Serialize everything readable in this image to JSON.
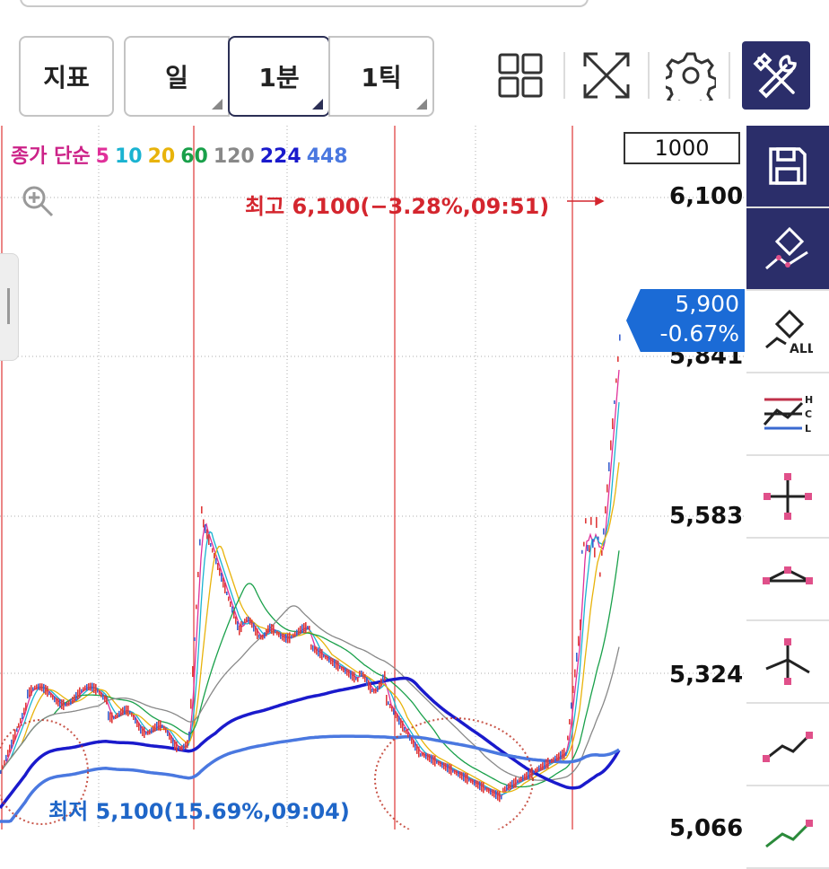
{
  "toolbar": {
    "indicator_label": "지표",
    "periods": [
      {
        "label": "일",
        "selected": false
      },
      {
        "label": "1분",
        "selected": true
      },
      {
        "label": "1틱",
        "selected": false
      }
    ],
    "icons": [
      "grid-layout-icon",
      "fullscreen-icon",
      "settings-icon",
      "tools-icon"
    ]
  },
  "chart": {
    "legend": [
      {
        "text": "종가 단순",
        "color": "#cc2288"
      },
      {
        "text": "5",
        "color": "#e0309a"
      },
      {
        "text": "10",
        "color": "#1ab3d1"
      },
      {
        "text": "20",
        "color": "#e8b30b"
      },
      {
        "text": "60",
        "color": "#19a04a"
      },
      {
        "text": "120",
        "color": "#888888"
      },
      {
        "text": "224",
        "color": "#1a1acc"
      },
      {
        "text": "448",
        "color": "#4a78e0"
      }
    ],
    "scale_box": "1000",
    "high_label": "최고 6,100(−3.28%,09:51)",
    "low_label": "최저 5,100(15.69%,09:04)",
    "current_price": "5,900",
    "current_change": "-0.67%",
    "price_ticks": [
      "6,100",
      "5,841",
      "5,583",
      "5,324",
      "5,066"
    ]
  },
  "chart_data": {
    "type": "line",
    "title": "",
    "series": [
      {
        "name": "5",
        "color": "#e0309a"
      },
      {
        "name": "10",
        "color": "#1ab3d1"
      },
      {
        "name": "20",
        "color": "#e8b30b"
      },
      {
        "name": "60",
        "color": "#19a04a"
      },
      {
        "name": "120",
        "color": "#888888"
      },
      {
        "name": "224",
        "color": "#1a1acc"
      },
      {
        "name": "448",
        "color": "#4a78e0"
      }
    ],
    "y_ticks": [
      6100,
      5841,
      5583,
      5324,
      5066
    ],
    "high": 6100,
    "low": 5100,
    "current": 5900
  },
  "sidebar": {
    "items": [
      "save-icon",
      "eraser-icon",
      "eraser-all-icon",
      "hcl-lines-icon",
      "crosshair-icon",
      "trend-line-icon",
      "fork-icon",
      "line-tool-icon",
      "add-line-icon"
    ],
    "all_label": "ALL"
  }
}
